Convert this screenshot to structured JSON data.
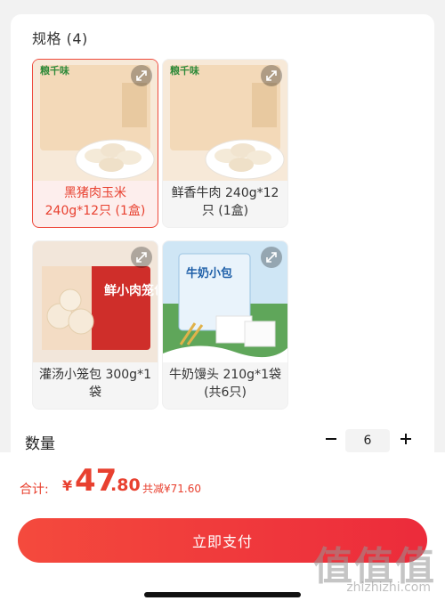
{
  "spec": {
    "title": "规格 (4)",
    "options": [
      {
        "label": "黑猪肉玉米 240g*12只 (1盒)",
        "brand": "粮千味",
        "selected": true
      },
      {
        "label": "鲜香牛肉 240g*12只 (1盒)",
        "brand": "粮千味",
        "selected": false
      },
      {
        "label": "灌汤小笼包 300g*1袋",
        "package_text": "鲜小肉笼包",
        "selected": false
      },
      {
        "label": "牛奶馒头 210g*1袋 (共6只)",
        "package_text": "牛奶小包",
        "selected": false
      }
    ]
  },
  "quantity": {
    "label": "数量",
    "value": "6"
  },
  "summary": {
    "total_label": "合计:",
    "currency": "¥",
    "amount_int": "47",
    "amount_dec": ".80",
    "saved_text": "共减¥71.60"
  },
  "pay_button": {
    "label": "立即支付"
  },
  "watermark": {
    "main": "值值值",
    "sub": "zhizhizhi.com"
  },
  "colors": {
    "accent": "#ee4b3e",
    "selected_bg": "#fdeeed",
    "button": "#f2383d"
  },
  "icons": {
    "expand": "expand-arrows-icon",
    "minus": "minus-icon",
    "plus": "plus-icon"
  }
}
